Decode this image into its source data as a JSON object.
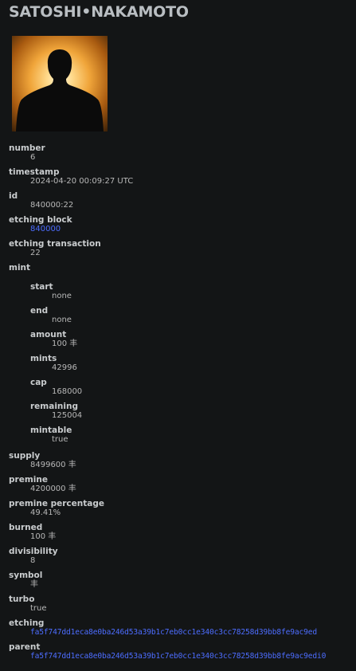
{
  "rune_name": "SATOSHI•NAKAMOTO",
  "portrait_icon": "silhouette-portrait",
  "fields": {
    "number": {
      "label": "number",
      "value": "6"
    },
    "timestamp": {
      "label": "timestamp",
      "value": "2024-04-20 00:09:27 UTC"
    },
    "id": {
      "label": "id",
      "value": "840000:22"
    },
    "etching_block": {
      "label": "etching block",
      "value": "840000"
    },
    "etching_transaction": {
      "label": "etching transaction",
      "value": "22"
    },
    "mint": {
      "label": "mint"
    },
    "supply": {
      "label": "supply",
      "value": "8499600 丰"
    },
    "premine": {
      "label": "premine",
      "value": "4200000 丰"
    },
    "premine_percentage": {
      "label": "premine percentage",
      "value": "49.41%"
    },
    "burned": {
      "label": "burned",
      "value": "100 丰"
    },
    "divisibility": {
      "label": "divisibility",
      "value": "8"
    },
    "symbol": {
      "label": "symbol",
      "value": "丰"
    },
    "turbo": {
      "label": "turbo",
      "value": "true"
    },
    "etching": {
      "label": "etching",
      "value": "fa5f747dd1eca8e0ba246d53a39b1c7eb0cc1e340c3cc78258d39bb8fe9ac9ed"
    },
    "parent": {
      "label": "parent",
      "value": "fa5f747dd1eca8e0ba246d53a39b1c7eb0cc1e340c3cc78258d39bb8fe9ac9edi0"
    }
  },
  "mint": {
    "start": {
      "label": "start",
      "value": "none"
    },
    "end": {
      "label": "end",
      "value": "none"
    },
    "amount": {
      "label": "amount",
      "value": "100 丰"
    },
    "mints": {
      "label": "mints",
      "value": "42996"
    },
    "cap": {
      "label": "cap",
      "value": "168000"
    },
    "remaining": {
      "label": "remaining",
      "value": "125004"
    },
    "mintable": {
      "label": "mintable",
      "value": "true"
    }
  },
  "colors": {
    "background": "#131516",
    "link": "#4d6dff",
    "heading": "#b9bec2"
  }
}
